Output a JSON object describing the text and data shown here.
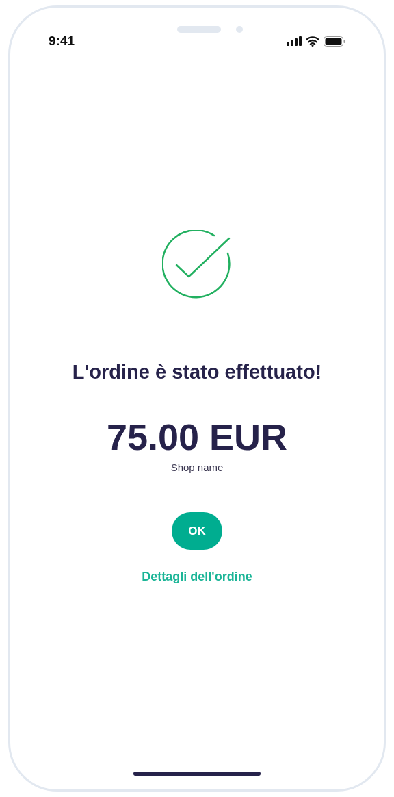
{
  "status_bar": {
    "time": "9:41"
  },
  "confirmation": {
    "title": "L'ordine è stato effettuato!",
    "amount": "75.00 EUR",
    "shop": "Shop name"
  },
  "buttons": {
    "ok": "OK",
    "details_link": "Dettagli dell'ordine"
  }
}
